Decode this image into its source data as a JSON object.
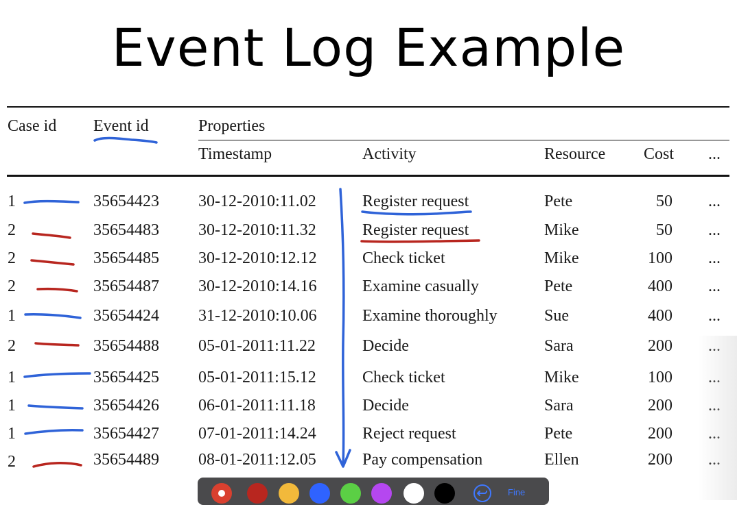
{
  "title": "Event Log Example",
  "table": {
    "headers": {
      "case_id": "Case id",
      "event_id": "Event id",
      "properties": "Properties",
      "timestamp": "Timestamp",
      "activity": "Activity",
      "resource": "Resource",
      "cost": "Cost",
      "more": "..."
    },
    "rows": [
      {
        "case_id": "1",
        "event_id": "35654423",
        "timestamp": "30-12-2010:11.02",
        "activity": "Register request",
        "resource": "Pete",
        "cost": "50",
        "more": "..."
      },
      {
        "case_id": "2",
        "event_id": "35654483",
        "timestamp": "30-12-2010:11.32",
        "activity": "Register request",
        "resource": "Mike",
        "cost": "50",
        "more": "..."
      },
      {
        "case_id": "2",
        "event_id": "35654485",
        "timestamp": "30-12-2010:12.12",
        "activity": "Check ticket",
        "resource": "Mike",
        "cost": "100",
        "more": "..."
      },
      {
        "case_id": "2",
        "event_id": "35654487",
        "timestamp": "30-12-2010:14.16",
        "activity": "Examine casually",
        "resource": "Pete",
        "cost": "400",
        "more": "..."
      },
      {
        "case_id": "1",
        "event_id": "35654424",
        "timestamp": "31-12-2010:10.06",
        "activity": "Examine thoroughly",
        "resource": "Sue",
        "cost": "400",
        "more": "..."
      },
      {
        "case_id": "2",
        "event_id": "35654488",
        "timestamp": "05-01-2011:11.22",
        "activity": "Decide",
        "resource": "Sara",
        "cost": "200",
        "more": "..."
      },
      {
        "case_id": "1",
        "event_id": "35654425",
        "timestamp": "05-01-2011:15.12",
        "activity": "Check ticket",
        "resource": "Mike",
        "cost": "100",
        "more": "..."
      },
      {
        "case_id": "1",
        "event_id": "35654426",
        "timestamp": "06-01-2011:11.18",
        "activity": "Decide",
        "resource": "Sara",
        "cost": "200",
        "more": "..."
      },
      {
        "case_id": "1",
        "event_id": "35654427",
        "timestamp": "07-01-2011:14.24",
        "activity": "Reject request",
        "resource": "Pete",
        "cost": "200",
        "more": "..."
      },
      {
        "case_id": "2",
        "event_id": "35654489",
        "timestamp": "08-01-2011:12.05",
        "activity": "Pay compensation",
        "resource": "Ellen",
        "cost": "200",
        "more": "..."
      }
    ]
  },
  "annotation_colors": {
    "blue": "#2f63d8",
    "red": "#b8261f"
  },
  "toolbar": {
    "swatches": [
      {
        "name": "red-pen",
        "color": "#d9402f",
        "selected": true
      },
      {
        "name": "dark-red",
        "color": "#b8261f",
        "selected": false
      },
      {
        "name": "yellow",
        "color": "#f2b93b",
        "selected": false
      },
      {
        "name": "blue",
        "color": "#2f63ff",
        "selected": false
      },
      {
        "name": "green",
        "color": "#5bcf45",
        "selected": false
      },
      {
        "name": "purple",
        "color": "#b547f0",
        "selected": false
      },
      {
        "name": "white",
        "color": "#ffffff",
        "selected": false
      },
      {
        "name": "black",
        "color": "#000000",
        "selected": false
      }
    ],
    "undo_icon": "undo-icon",
    "done_label": "Fine"
  }
}
